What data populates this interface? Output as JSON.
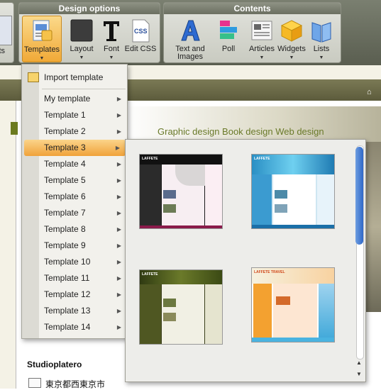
{
  "ribbon": {
    "partial_left_label": "cts",
    "design_group": {
      "title": "Design options",
      "buttons": [
        {
          "label": "Templates",
          "icon": "templates-icon",
          "active": true
        },
        {
          "label": "Layout",
          "icon": "layout-icon"
        },
        {
          "label": "Font",
          "icon": "font-icon"
        },
        {
          "label": "Edit CSS",
          "icon": "css-icon"
        }
      ]
    },
    "contents_group": {
      "title": "Contents",
      "buttons": [
        {
          "label": "Text and Images",
          "icon": "text-images-icon"
        },
        {
          "label": "Poll",
          "icon": "poll-icon"
        },
        {
          "label": "Articles",
          "icon": "articles-icon"
        },
        {
          "label": "Widgets",
          "icon": "widgets-icon"
        },
        {
          "label": "Lists",
          "icon": "lists-icon"
        }
      ]
    }
  },
  "menu": {
    "import_label": "Import template",
    "items": [
      "My template",
      "Template 1",
      "Template 2",
      "Template 3",
      "Template 4",
      "Template 5",
      "Template 6",
      "Template 7",
      "Template 8",
      "Template 9",
      "Template 10",
      "Template 11",
      "Template 12",
      "Template 13",
      "Template 14"
    ],
    "highlighted": "Template 3"
  },
  "gallery": {
    "thumbnails": [
      {
        "theme": "dark-magenta",
        "brand": "LAFFETE"
      },
      {
        "theme": "blue",
        "brand": "LAFFETE"
      },
      {
        "theme": "olive",
        "brand": "LAFFETE"
      },
      {
        "theme": "travel",
        "brand": "LAFFETE TRAVEL"
      }
    ]
  },
  "page": {
    "tagline": "Graphic design  Book design Web design",
    "studio_name": "Studioplatero",
    "address": "東京都西東京市"
  },
  "colors": {
    "highlight": "#f0a23a",
    "accent_green": "#6a7a2a",
    "scroll_blue": "#2f68c8"
  }
}
